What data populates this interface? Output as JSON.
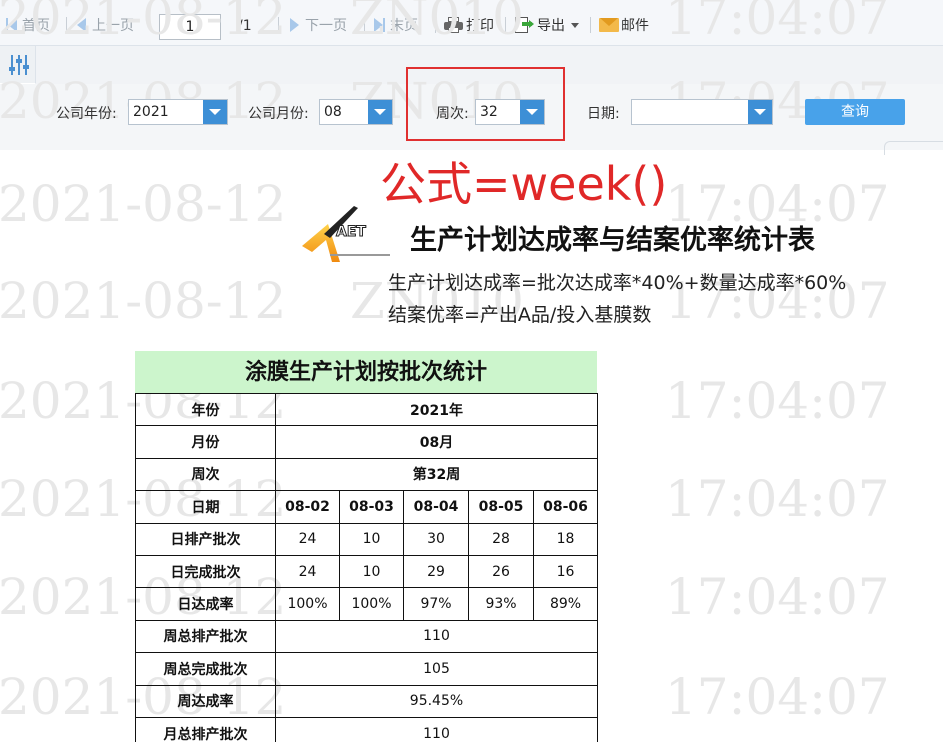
{
  "toolbar": {
    "first_page": "首页",
    "prev_page": "上一页",
    "page_value": "1",
    "page_total": "/1",
    "next_page": "下一页",
    "last_page": "末页",
    "print": "打印",
    "export": "导出",
    "email": "邮件"
  },
  "filters": {
    "year_label": "公司年份:",
    "year_value": "2021",
    "month_label": "公司月份:",
    "month_value": "08",
    "week_label": "周次:",
    "week_value": "32",
    "date_label": "日期:",
    "date_value": "",
    "query_button": "查询"
  },
  "annotation": {
    "formula": "公式=week()"
  },
  "watermark": {
    "date": "2021-08-12",
    "code": "ZN010",
    "time": "17:04:07"
  },
  "report": {
    "logo_text": "AET",
    "title": "生产计划达成率与结案优率统计表",
    "subtitle_1": "生产计划达成率=批次达成率*40%+数量达成率*60%",
    "subtitle_2": "结案优率=产出A品/投入基膜数",
    "table_title": "涂膜生产计划按批次统计",
    "rows": {
      "year_label": "年份",
      "year_value": "2021年",
      "month_label": "月份",
      "month_value": "08月",
      "week_label": "周次",
      "week_value": "第32周",
      "date_label": "日期",
      "dates": [
        "08-02",
        "08-03",
        "08-04",
        "08-05",
        "08-06"
      ],
      "daily_planned_label": "日排产批次",
      "daily_planned": [
        "24",
        "10",
        "30",
        "28",
        "18"
      ],
      "daily_done_label": "日完成批次",
      "daily_done": [
        "24",
        "10",
        "29",
        "26",
        "16"
      ],
      "daily_rate_label": "日达成率",
      "daily_rate": [
        "100%",
        "100%",
        "97%",
        "93%",
        "89%"
      ],
      "week_planned_label": "周总排产批次",
      "week_planned": "110",
      "week_done_label": "周总完成批次",
      "week_done": "105",
      "week_rate_label": "周达成率",
      "week_rate": "95.45%",
      "month_planned_label": "月总排产批次",
      "month_planned": "110"
    }
  }
}
